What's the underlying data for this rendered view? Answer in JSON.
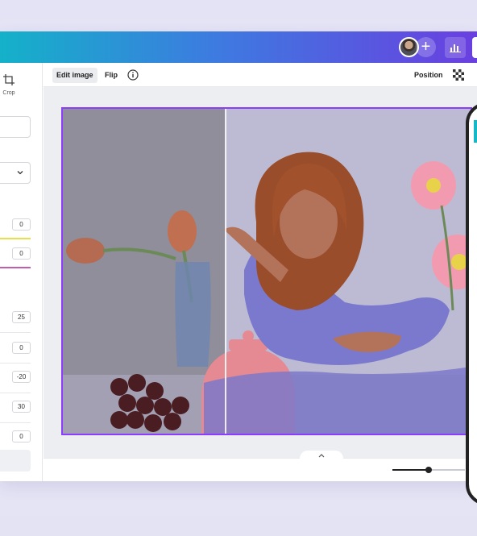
{
  "toolbar": {
    "edit_image_label": "Edit image",
    "flip_label": "Flip",
    "position_label": "Position"
  },
  "left_panel": {
    "crop_label": "Crop",
    "adjust_values": [
      "0",
      "0",
      "25",
      "0",
      "-20",
      "30",
      "0"
    ]
  },
  "zoom": {
    "level_fraction": 0.5
  },
  "colors": {
    "brand_gradient_start": "#14b1c9",
    "brand_gradient_end": "#6a3fe0",
    "selection": "#8b3dff",
    "accent_yellow": "#e8e04a",
    "accent_pink": "#c45bb0"
  }
}
